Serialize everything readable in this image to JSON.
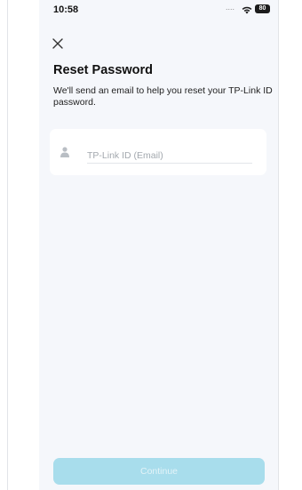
{
  "status_bar": {
    "time": "10:58",
    "signal": "....",
    "battery": "80"
  },
  "reset_password": {
    "title": "Reset Password",
    "description": "We'll send an email to help you reset your TP-Link ID password.",
    "email_placeholder": "TP-Link ID (Email)",
    "email_value": "",
    "continue_label": "Continue",
    "continue_enabled": false
  },
  "icons": {
    "close": "close-icon",
    "user": "user-icon",
    "wifi": "wifi-icon",
    "battery": "battery-icon"
  },
  "colors": {
    "background": "#f5f7fb",
    "card": "#ffffff",
    "button_disabled": "#a8ddec",
    "button_text_disabled": "#e3f3f8",
    "placeholder": "#a3a8ae"
  }
}
